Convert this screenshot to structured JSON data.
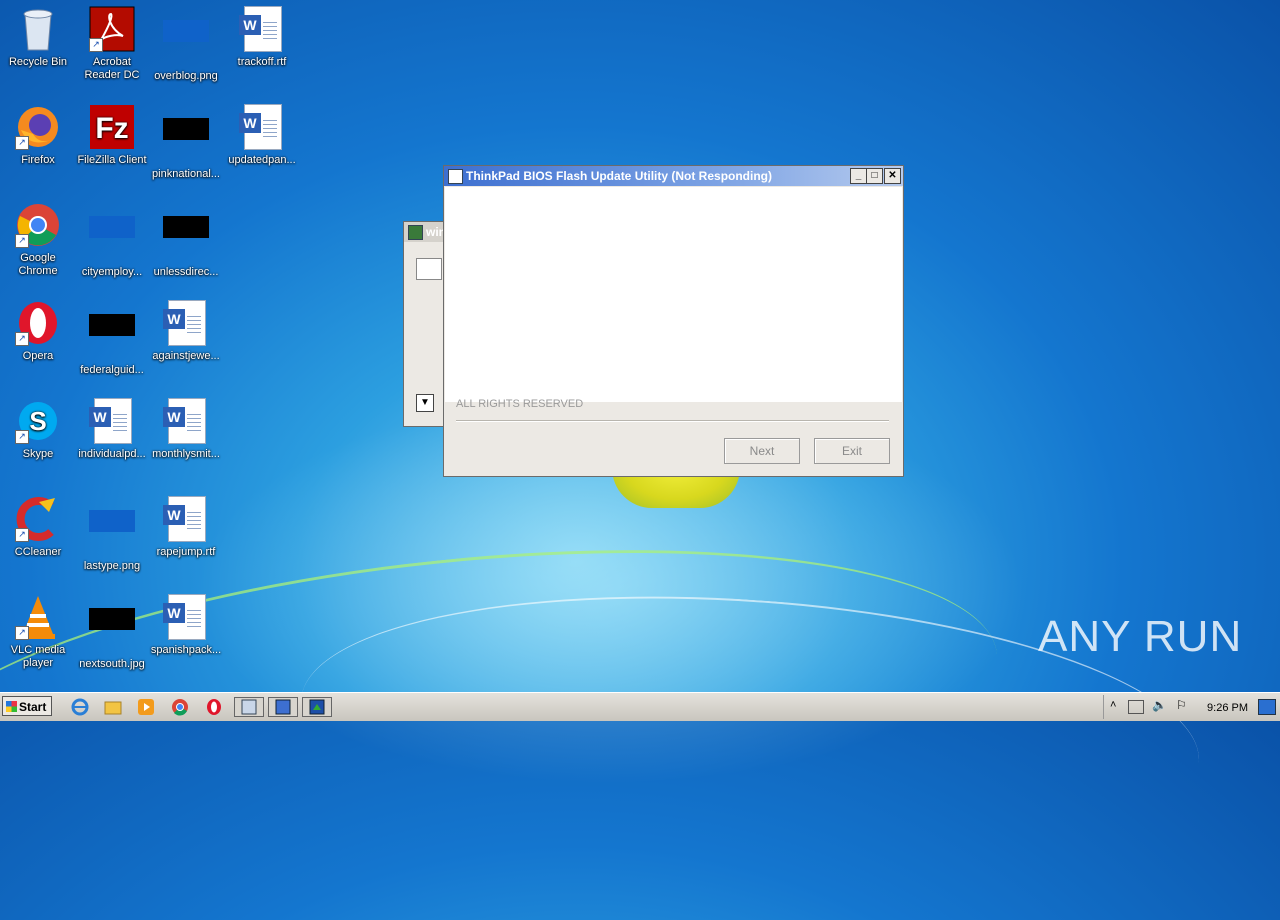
{
  "desktop": {
    "icons": [
      {
        "label": "Recycle Bin",
        "icon": "recycle-bin-icon"
      },
      {
        "label": "Acrobat Reader DC",
        "icon": "acrobat-icon"
      },
      {
        "label": "overblog.png",
        "icon": "image-file-icon"
      },
      {
        "label": "trackoff.rtf",
        "icon": "word-doc-icon"
      },
      {
        "label": "Firefox",
        "icon": "firefox-icon"
      },
      {
        "label": "FileZilla Client",
        "icon": "filezilla-icon"
      },
      {
        "label": "pinknational...",
        "icon": "image-file-icon"
      },
      {
        "label": "updatedpan...",
        "icon": "word-doc-icon"
      },
      {
        "label": "Google Chrome",
        "icon": "chrome-icon"
      },
      {
        "label": "cityemploy...",
        "icon": "image-file-icon"
      },
      {
        "label": "unlessdirec...",
        "icon": "image-file-icon"
      },
      {
        "label": "Opera",
        "icon": "opera-icon"
      },
      {
        "label": "federalguid...",
        "icon": "image-file-icon"
      },
      {
        "label": "againstjewe...",
        "icon": "word-doc-icon"
      },
      {
        "label": "Skype",
        "icon": "skype-icon"
      },
      {
        "label": "individualpd...",
        "icon": "word-doc-icon"
      },
      {
        "label": "monthlysmit...",
        "icon": "word-doc-icon"
      },
      {
        "label": "CCleaner",
        "icon": "ccleaner-icon"
      },
      {
        "label": "lastype.png",
        "icon": "image-file-icon"
      },
      {
        "label": "rapejump.rtf",
        "icon": "word-doc-icon"
      },
      {
        "label": "VLC media player",
        "icon": "vlc-icon"
      },
      {
        "label": "nextsouth.jpg",
        "icon": "image-file-icon"
      },
      {
        "label": "spanishpack...",
        "icon": "word-doc-icon"
      }
    ]
  },
  "background_window": {
    "title": "win"
  },
  "main_window": {
    "title": "ThinkPad BIOS Flash Update Utility (Not Responding)",
    "copyright": "ALL RIGHTS RESERVED",
    "next_label": "Next",
    "exit_label": "Exit"
  },
  "taskbar": {
    "start_label": "Start",
    "clock": "9:26 PM"
  },
  "watermark": "ANY RUN",
  "colors": {
    "titlebar": "#3d6fd0",
    "desktop": "#1476cf"
  }
}
